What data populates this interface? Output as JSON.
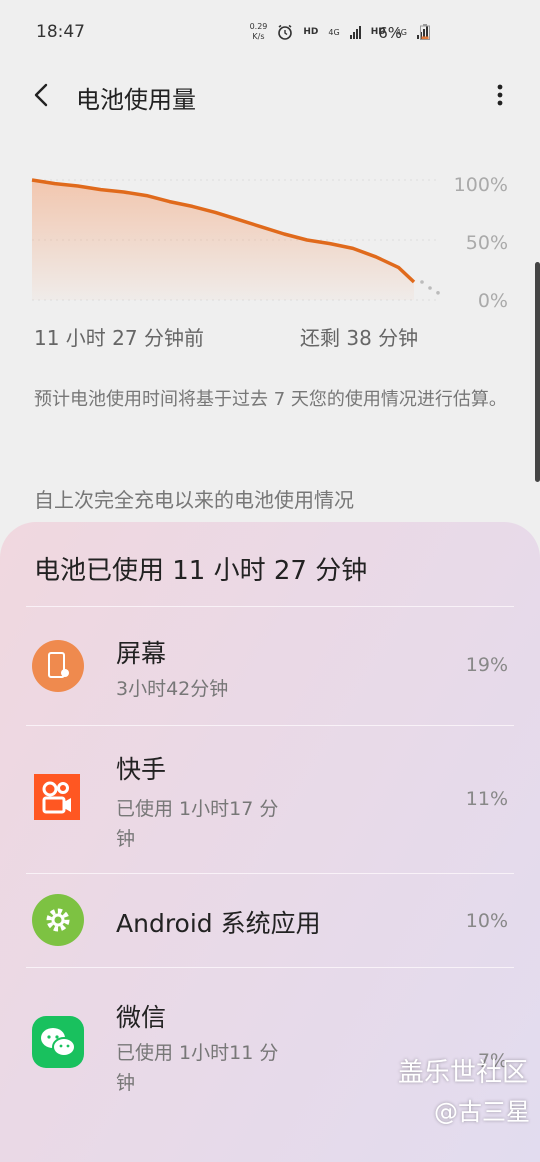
{
  "status": {
    "time": "18:47",
    "net_speed_value": "0.29",
    "net_speed_unit": "K/s",
    "hd1": "HD",
    "net1": "4G",
    "hd2": "HD",
    "net2": "4G",
    "battery": "6%",
    "battery_color": "#e07a3a"
  },
  "header": {
    "title": "电池使用量"
  },
  "chart_data": {
    "type": "area",
    "x_start_label": "11 小时 27 分钟前",
    "x_end_label": "还剩 38 分钟",
    "y_ticks": [
      "100%",
      "50%",
      "0%"
    ],
    "ylim": [
      0,
      100
    ],
    "x": [
      0,
      0.06,
      0.12,
      0.18,
      0.24,
      0.3,
      0.36,
      0.42,
      0.48,
      0.54,
      0.6,
      0.66,
      0.72,
      0.78,
      0.84,
      0.9,
      0.96,
      1.0
    ],
    "values": [
      100,
      97,
      95,
      92,
      90,
      87,
      82,
      78,
      73,
      67,
      61,
      55,
      50,
      47,
      43,
      36,
      27,
      15
    ],
    "projection": [
      15,
      10,
      6
    ],
    "line_color": "#e06a1c"
  },
  "note": "预计电池使用时间将基于过去 7 天您的使用情况进行估算。",
  "section_head": "自上次完全充电以来的电池使用情况",
  "card": {
    "title": "电池已使用 11 小时 27 分钟",
    "apps": [
      {
        "name": "屏幕",
        "sub": "3小时42分钟",
        "pct": "19%",
        "icon": "screen-icon",
        "color": "#ef8a4e"
      },
      {
        "name": "快手",
        "sub": "已使用 1小时17 分钟",
        "pct": "11%",
        "icon": "kuaishou-icon",
        "color": "#ff5722"
      },
      {
        "name": "Android 系统应用",
        "sub": "",
        "pct": "10%",
        "icon": "android-system-icon",
        "color": "#7dc242"
      },
      {
        "name": "微信",
        "sub": "已使用 1小时11 分钟",
        "pct": "7%",
        "icon": "wechat-icon",
        "color": "#19c15e"
      }
    ]
  },
  "watermark": {
    "line1": "盖乐世社区",
    "line2": "@古三星"
  }
}
